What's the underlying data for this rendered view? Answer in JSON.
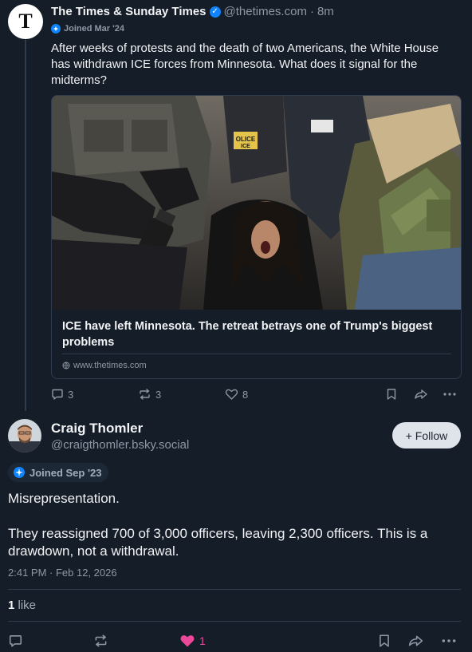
{
  "post": {
    "author_name": "The Times & Sunday Times",
    "author_handle": "@thetimes.com",
    "separator": "·",
    "time_ago": "8m",
    "avatar_letter": "T",
    "joined": "Joined Mar '24",
    "text": "After weeks of protests and the death of two Americans, the White House has withdrawn ICE forces from Minnesota. What does it signal for the midterms?",
    "link_card": {
      "image_vest_text": "OLICE\nICE",
      "title": "ICE have left Minnesota. The retreat betrays one of Trump's biggest problems",
      "domain": "www.thetimes.com"
    },
    "actions": {
      "replies": "3",
      "reposts": "3",
      "likes": "8"
    }
  },
  "reply": {
    "author_name": "Craig Thomler",
    "author_handle": "@craigthomler.bsky.social",
    "follow_label": "+ Follow",
    "joined": "Joined Sep '23",
    "text_line1": "Misrepresentation.",
    "text_line2": "They reassigned 700 of 3,000 officers, leaving 2,300 officers. This is a drawdown, not a withdrawal.",
    "timestamp": "2:41 PM · Feb 12, 2026",
    "likes_count": "1",
    "likes_word": "like",
    "actions": {
      "likes": "1"
    }
  },
  "colors": {
    "background": "#151d28",
    "accent_blue": "#1083fe",
    "like_pink": "#ec4899",
    "muted": "#8d98a5"
  }
}
